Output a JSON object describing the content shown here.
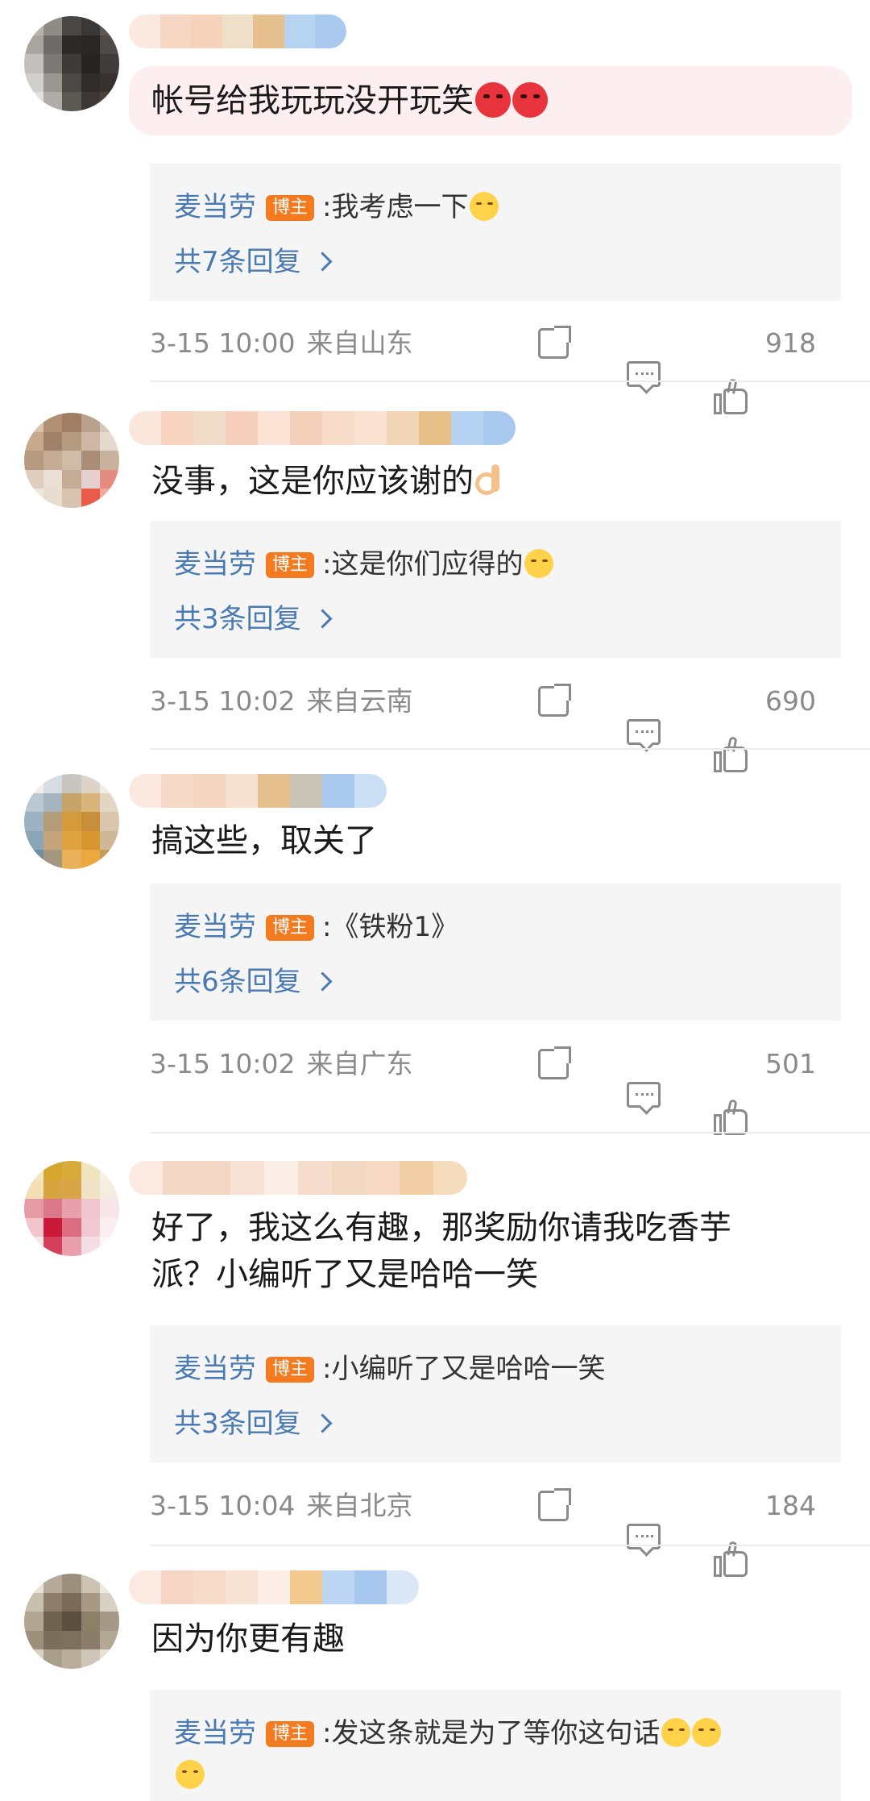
{
  "colors": {
    "link": "#4a7ab3",
    "badge": "#f47a20",
    "meta": "#8a8a8a",
    "reply_bg": "#f5f5f5"
  },
  "comments": [
    {
      "text": "帐号给我玩玩没开玩笑",
      "emoji": [
        "angry-face",
        "angry-face"
      ],
      "reply": {
        "author": "麦当劳",
        "badge": "博主",
        "text": "我考虑一下",
        "emoji": [
          "smirk-face"
        ]
      },
      "reply_count": "共7条回复",
      "time": "3-15 10:00",
      "location": "来自山东",
      "likes": "918"
    },
    {
      "text": "没事，这是你应该谢的",
      "emoji": [
        "ok-hand"
      ],
      "reply": {
        "author": "麦当劳",
        "badge": "博主",
        "text": "这是你们应得的",
        "emoji": [
          "grin-face"
        ]
      },
      "reply_count": "共3条回复",
      "time": "3-15 10:02",
      "location": "来自云南",
      "likes": "690"
    },
    {
      "text": "搞这些，取关了",
      "emoji": [],
      "reply": {
        "author": "麦当劳",
        "badge": "博主",
        "text": "《铁粉1》",
        "emoji": []
      },
      "reply_count": "共6条回复",
      "time": "3-15 10:02",
      "location": "来自广东",
      "likes": "501"
    },
    {
      "text": "好了，我这么有趣，那奖励你请我吃香芋派？小编听了又是哈哈一笑",
      "line1": "好了，我这么有趣，那奖励你请我吃香芋",
      "line2": "派？小编听了又是哈哈一笑",
      "emoji": [],
      "reply": {
        "author": "麦当劳",
        "badge": "博主",
        "text": "小编听了又是哈哈一笑",
        "emoji": []
      },
      "reply_count": "共3条回复",
      "time": "3-15 10:04",
      "location": "来自北京",
      "likes": "184"
    },
    {
      "text": "因为你更有趣",
      "emoji": [],
      "reply": {
        "author": "麦当劳",
        "badge": "博主",
        "text": "发这条就是为了等你这句话",
        "emoji": [
          "smirk-face",
          "smirk-face",
          "smirk-face"
        ]
      }
    }
  ],
  "colon": ":"
}
